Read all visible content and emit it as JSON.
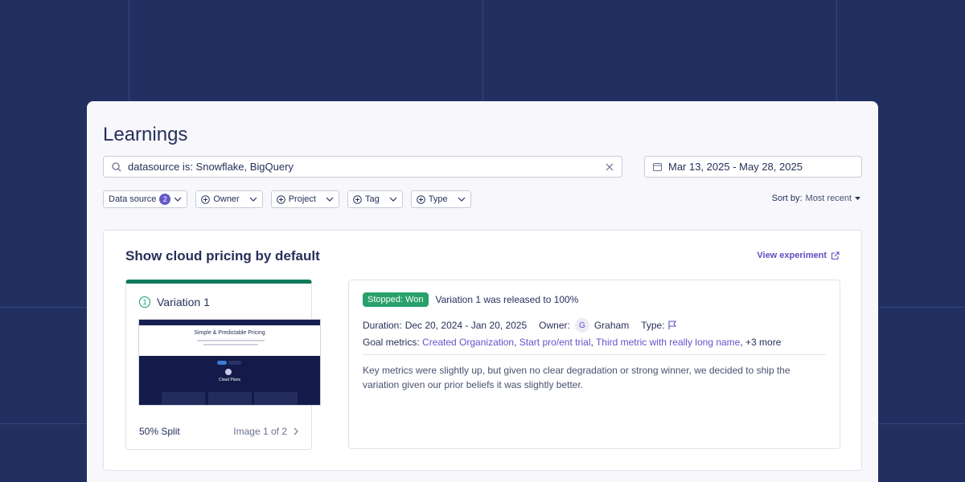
{
  "page": {
    "title": "Learnings"
  },
  "search": {
    "value": "datasource is: Snowflake, BigQuery"
  },
  "date_range": {
    "value": "Mar 13, 2025 - May 28, 2025"
  },
  "filters": [
    {
      "label": "Data source",
      "count": "2"
    },
    {
      "label": "Owner"
    },
    {
      "label": "Project"
    },
    {
      "label": "Tag"
    },
    {
      "label": "Type"
    }
  ],
  "sort": {
    "label": "Sort by:",
    "value": "Most recent"
  },
  "experiment": {
    "title": "Show cloud pricing by default",
    "view_link": "View experiment",
    "variation": {
      "number": "1",
      "name": "Variation 1",
      "split": "50% Split",
      "image_counter": "Image 1 of 2",
      "screenshot": {
        "headline": "Simple & Predictable Pricing",
        "section": "Cloud Plans"
      }
    },
    "status_badge": "Stopped: Won",
    "status_text": "Variation 1 was released to 100%",
    "duration_label": "Duration:",
    "duration_value": "Dec 20, 2024 - Jan 20, 2025",
    "owner_label": "Owner:",
    "owner_initial": "G",
    "owner_name": "Graham",
    "type_label": "Type:",
    "goal_label": "Goal metrics:",
    "goal_metrics": [
      "Created Organization",
      "Start pro/ent trial",
      "Third metric with really long name"
    ],
    "goal_more": "+3 more",
    "notes": "Key metrics were slightly up, but given no clear degradation or strong winner, we decided to ship the variation given our prior beliefs it was slightly better."
  },
  "colors": {
    "background": "#213060",
    "accent": "#6559c7",
    "won": "#27a06a"
  }
}
